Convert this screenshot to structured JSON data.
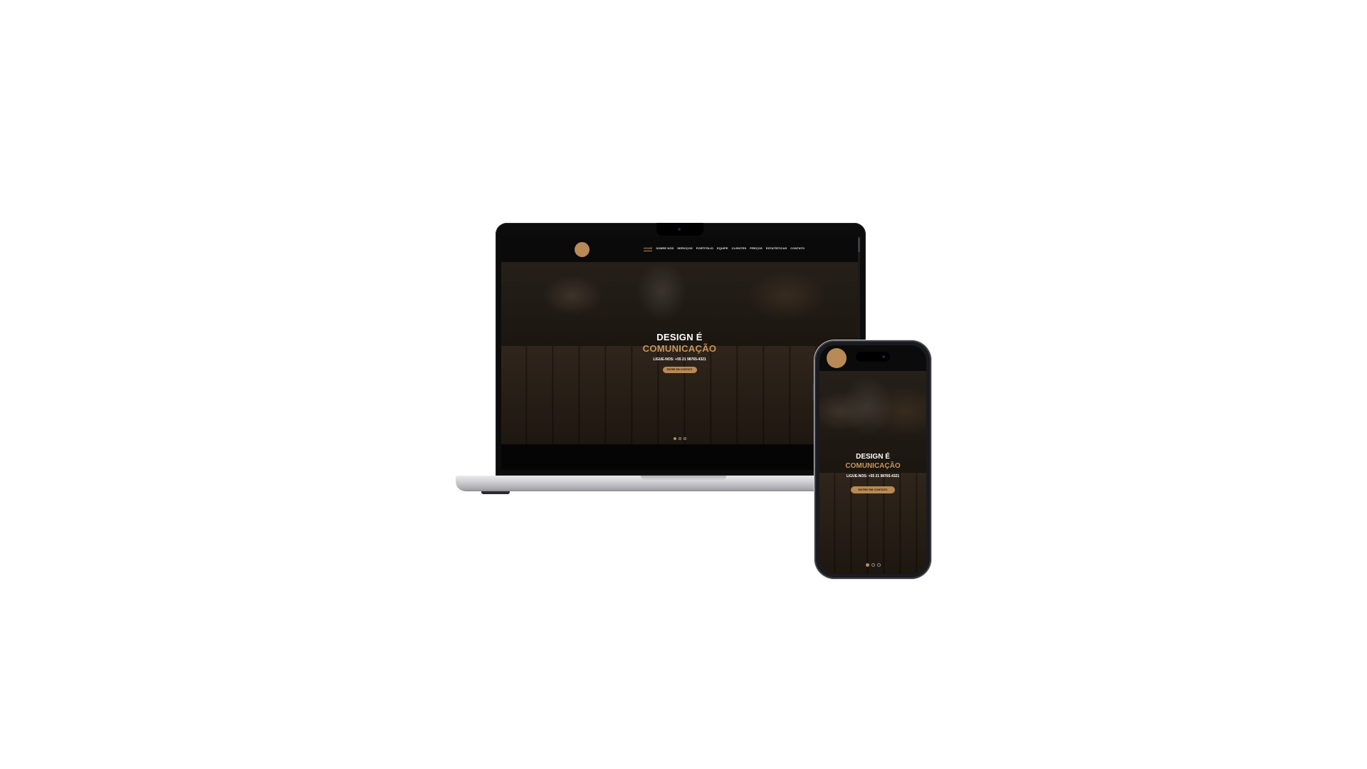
{
  "brand": {
    "accent": "#b98a55",
    "accent_text": "#c8955a",
    "dark_bg": "#0a0a0a"
  },
  "nav": {
    "items": [
      "HOME",
      "SOBRE NÓS",
      "SERVIÇOS",
      "PORTFÓLIO",
      "EQUIPE",
      "CLIENTES",
      "PREÇOS",
      "ESTATÍSTICAS",
      "CONTATO"
    ],
    "active_index": 0
  },
  "hero": {
    "title_line1": "DESIGN É",
    "title_line2": "COMUNICAÇÃO",
    "phone_text": "LIGUE-NOS: +55 21 98765-4321",
    "cta_label": "ENTRE EM CONTATO",
    "slides": 3,
    "active_slide": 1
  }
}
